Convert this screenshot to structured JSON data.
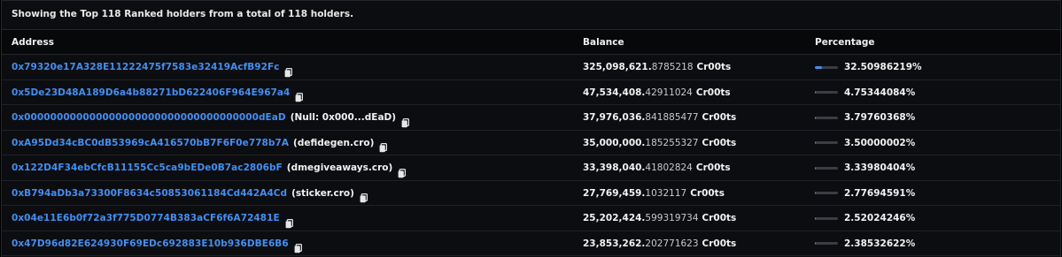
{
  "summary": "Showing the Top 118 Ranked holders from a total of 118 holders.",
  "columns": {
    "address": "Address",
    "balance": "Balance",
    "percentage": "Percentage"
  },
  "rows": [
    {
      "address": "0x79320e17A328E11222475f7583e32419AcfB92Fc",
      "alias": "",
      "balance_int": "325,098,621.",
      "balance_frac": "8785218",
      "unit": "Cr00ts",
      "percentage": "32.50986219%",
      "share": 0.3251
    },
    {
      "address": "0x5De23D48A189D6a4b88271bD622406F964E967a4",
      "alias": "",
      "balance_int": "47,534,408.",
      "balance_frac": "42911024",
      "unit": "Cr00ts",
      "percentage": "4.75344084%",
      "share": 0.0475
    },
    {
      "address": "0x000000000000000000000000000000000000dEaD",
      "alias": "(Null: 0x000...dEaD)",
      "balance_int": "37,976,036.",
      "balance_frac": "841885477",
      "unit": "Cr00ts",
      "percentage": "3.79760368%",
      "share": 0.038
    },
    {
      "address": "0xA95Dd34cBC0dB53969cA416570bB7F6F0e778b7A",
      "alias": "(defidegen.cro)",
      "balance_int": "35,000,000.",
      "balance_frac": "185255327",
      "unit": "Cr00ts",
      "percentage": "3.50000002%",
      "share": 0.035
    },
    {
      "address": "0x122D4F34ebCfcB11155Cc5ca9bEDe0B7ac2806bF",
      "alias": "(dmegiveaways.cro)",
      "balance_int": "33,398,040.",
      "balance_frac": "41802824",
      "unit": "Cr00ts",
      "percentage": "3.33980404%",
      "share": 0.0334
    },
    {
      "address": "0xB794aDb3a73300F8634c50853061184Cd442A4Cd",
      "alias": "(sticker.cro)",
      "balance_int": "27,769,459.",
      "balance_frac": "1032117",
      "unit": "Cr00ts",
      "percentage": "2.77694591%",
      "share": 0.0278
    },
    {
      "address": "0x04e11E6b0f72a3f775D0774B383aCF6f6A72481E",
      "alias": "",
      "balance_int": "25,202,424.",
      "balance_frac": "599319734",
      "unit": "Cr00ts",
      "percentage": "2.52024246%",
      "share": 0.0252
    },
    {
      "address": "0x47D96d82E624930F69EDc692883E10b936DBE6B6",
      "alias": "",
      "balance_int": "23,853,262.",
      "balance_frac": "202771623",
      "unit": "Cr00ts",
      "percentage": "2.38532622%",
      "share": 0.0239
    }
  ],
  "colors": {
    "link": "#3f8ff2",
    "bar_fill": "#3f8ff2",
    "bar_track": "#3a3d44",
    "background": "#0c0d10"
  },
  "icons": {
    "copy": "copy-icon"
  }
}
